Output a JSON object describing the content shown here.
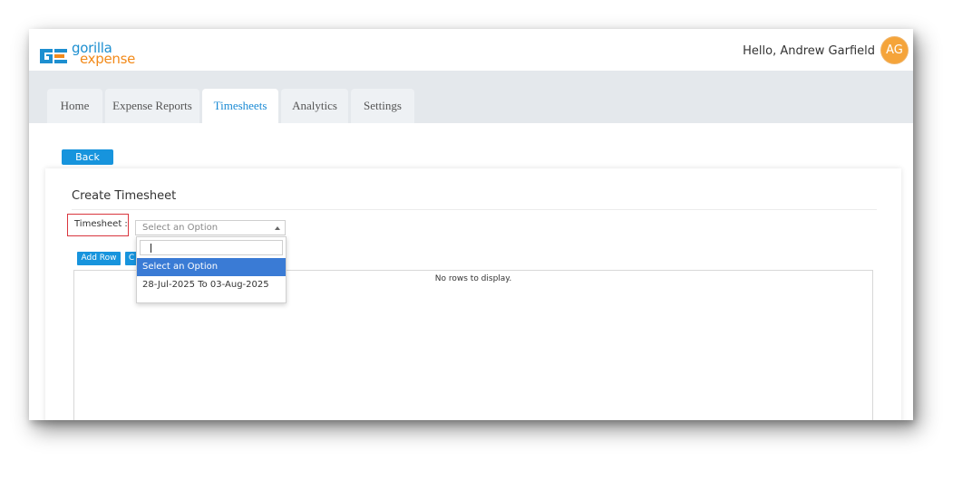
{
  "header": {
    "logo_word1": "gorilla",
    "logo_word2": "expense",
    "greeting": "Hello, Andrew Garfield",
    "avatar_initials": "AG"
  },
  "nav": {
    "tabs": [
      {
        "label": "Home",
        "active": false
      },
      {
        "label": "Expense Reports",
        "active": false
      },
      {
        "label": "Timesheets",
        "active": true
      },
      {
        "label": "Analytics",
        "active": false
      },
      {
        "label": "Settings",
        "active": false
      }
    ]
  },
  "content": {
    "back_label": "Back",
    "card_title": "Create Timesheet",
    "timesheet_label": "Timesheet :",
    "select_value": "Select an Option",
    "add_row_label": "Add Row",
    "second_button_label": "C",
    "grid_empty_text": "No rows to display."
  },
  "dropdown": {
    "search_value": "",
    "options": [
      {
        "label": "Select an Option",
        "selected": true
      },
      {
        "label": "28-Jul-2025 To 03-Aug-2025",
        "selected": false
      }
    ]
  },
  "colors": {
    "accent_blue": "#1794dd",
    "active_tab_text": "#1a8ad4",
    "highlight_red": "#d9363e",
    "selected_option": "#3a7bd5",
    "avatar_orange": "#f5a43a"
  }
}
